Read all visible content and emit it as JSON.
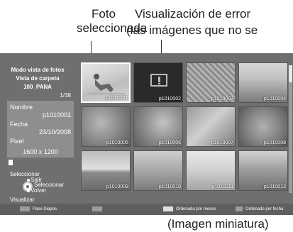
{
  "callouts": {
    "selected": "Foto seleccionada",
    "error_line1": "Visualización de error",
    "error_line2": "(las imágenes que no se",
    "thumbnail": "(Imagen miniatura)"
  },
  "sidebar": {
    "mode": "Modo vista de fotos",
    "view": "Vista de carpeta",
    "folder": "100_PANA",
    "count": "1/38",
    "name_label": "Nombre",
    "name_value": "p1010001",
    "date_label": "Fecha",
    "date_value": "23/10/2008",
    "pixel_label": "Pixel",
    "pixel_value": "1600 x 1200",
    "select_label": "Seleccionar",
    "exit_label": "Salir",
    "select_ok_label": "Seleccionar",
    "back_label": "Volver",
    "view_label": "Visualizar"
  },
  "thumbnails": [
    {
      "label": "p1010001",
      "selected": true
    },
    {
      "label": "p1010002",
      "error": true,
      "error_icon": "broken-image-icon"
    },
    {
      "label": "p1010003"
    },
    {
      "label": "p1010004"
    },
    {
      "label": "p1010005"
    },
    {
      "label": "p1010006"
    },
    {
      "label": "p1010007"
    },
    {
      "label": "p1010008"
    },
    {
      "label": "p1010009"
    },
    {
      "label": "p1010010"
    },
    {
      "label": "p1010011"
    },
    {
      "label": "p1010012"
    }
  ],
  "scroll_position": 0.0,
  "bottom_bar": {
    "slideshow": "Pase Diapos.",
    "sort_month": "Ordenado por meses",
    "sort_date": "Ordenado por fecha",
    "colors": {
      "red": "#cc2222",
      "green": "#229944",
      "yellow": "#d8c21c",
      "blue": "#2f54c8"
    }
  }
}
